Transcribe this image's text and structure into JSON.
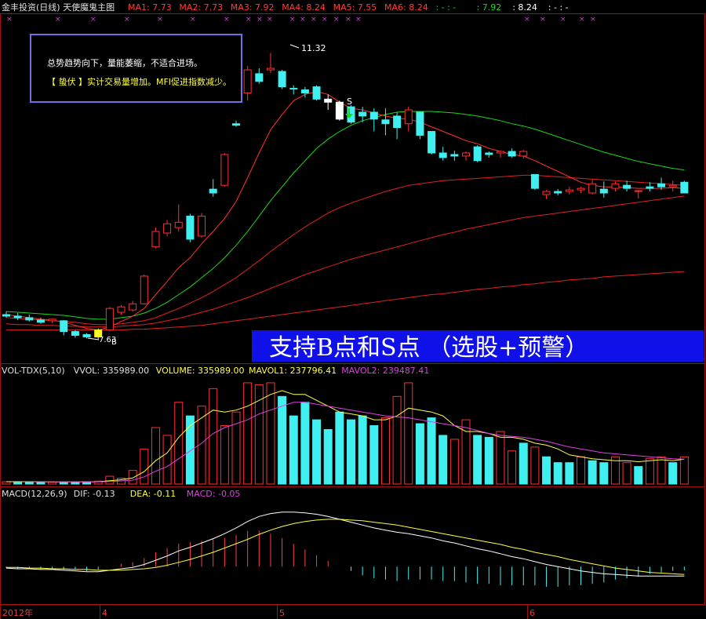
{
  "header": {
    "title": "金丰投资(日线) 天使魔鬼主图",
    "ma": [
      {
        "label": "MA1: 7.73",
        "color": "#ff3b3b"
      },
      {
        "label": "MA2: 7.73",
        "color": "#ff3b3b"
      },
      {
        "label": "MA3: 7.92",
        "color": "#ff3b3b"
      },
      {
        "label": "MA4: 8.24",
        "color": "#ff3b3b"
      },
      {
        "label": "MA5: 7.55",
        "color": "#ff3b3b"
      },
      {
        "label": "MA6: 8.24",
        "color": "#ff3b3b"
      },
      {
        "label": ": - : -",
        "color": "#18d818"
      },
      {
        "label": ": 7.92",
        "color": "#18d818"
      },
      {
        "label": ": 8.24",
        "color": "#ffffff"
      },
      {
        "label": ": - : -",
        "color": "#ffffff"
      }
    ]
  },
  "info_box": {
    "line1": "总势趋势向下，量能萎缩，不适合进场。",
    "line2": "【 蛰伏 】实计交易量增加。MFI促进指数减少。"
  },
  "banner": {
    "text": "支持B点和S点 （选股+预警）",
    "bg": "#1010e8"
  },
  "markers": {
    "b": "B",
    "s": "S",
    "high": "11.32",
    "low": "7.63"
  },
  "vol_header": [
    {
      "label": "VOL-TDX(5,10)",
      "color": "#e0e0e0"
    },
    {
      "label": "VVOL: 335989.00",
      "color": "#e0e0e0"
    },
    {
      "label": "VOLUME: 335989.00",
      "color": "#ffff40"
    },
    {
      "label": "MAVOL1: 237796.41",
      "color": "#ffff40"
    },
    {
      "label": "MAVOL2: 239487.41",
      "color": "#e040e0"
    }
  ],
  "macd_header": [
    {
      "label": "MACD(12,26,9)",
      "color": "#e0e0e0"
    },
    {
      "label": "DIF: -0.13",
      "color": "#e0e0e0"
    },
    {
      "label": "DEA: -0.11",
      "color": "#ffff40"
    },
    {
      "label": "MACD: -0.05",
      "color": "#e040e0"
    }
  ],
  "date_axis": [
    "2012年",
    "4",
    "5",
    "6"
  ],
  "chart_data": {
    "type": "candlestick",
    "price_ylim": [
      7.4,
      11.6
    ],
    "candles": [
      [
        7.92,
        7.96,
        7.88,
        7.9
      ],
      [
        7.9,
        7.94,
        7.85,
        7.88
      ],
      [
        7.88,
        7.92,
        7.83,
        7.85
      ],
      [
        7.85,
        7.88,
        7.8,
        7.82
      ],
      [
        7.84,
        7.87,
        7.81,
        7.86
      ],
      [
        7.84,
        7.85,
        7.65,
        7.7
      ],
      [
        7.7,
        7.72,
        7.62,
        7.65
      ],
      [
        7.66,
        7.68,
        7.61,
        7.63
      ],
      [
        7.63,
        7.74,
        7.6,
        7.72
      ],
      [
        7.72,
        8.02,
        7.7,
        8.0
      ],
      [
        7.95,
        8.04,
        7.92,
        8.02
      ],
      [
        7.98,
        8.1,
        7.96,
        8.06
      ],
      [
        8.06,
        8.44,
        8.05,
        8.42
      ],
      [
        8.8,
        9.05,
        8.78,
        9.0
      ],
      [
        8.98,
        9.15,
        8.94,
        9.1
      ],
      [
        9.05,
        9.35,
        9.0,
        9.12
      ],
      [
        9.2,
        9.23,
        8.86,
        8.9
      ],
      [
        8.94,
        9.24,
        8.92,
        9.2
      ],
      [
        9.55,
        9.68,
        9.45,
        9.5
      ],
      [
        9.6,
        10.02,
        9.58,
        10.0
      ],
      [
        10.4,
        10.44,
        10.36,
        10.38
      ],
      [
        10.8,
        11.15,
        10.7,
        11.1
      ],
      [
        11.05,
        11.12,
        10.92,
        10.95
      ],
      [
        11.1,
        11.32,
        11.06,
        11.12
      ],
      [
        11.08,
        11.1,
        10.85,
        10.88
      ],
      [
        10.86,
        10.9,
        10.78,
        10.85
      ],
      [
        10.84,
        10.88,
        10.74,
        10.8
      ],
      [
        10.88,
        10.9,
        10.7,
        10.72
      ],
      [
        10.72,
        10.78,
        10.58,
        10.68
      ],
      [
        10.68,
        10.7,
        10.44,
        10.46
      ],
      [
        10.62,
        10.64,
        10.4,
        10.42
      ],
      [
        10.55,
        10.62,
        10.42,
        10.5
      ],
      [
        10.55,
        10.6,
        10.3,
        10.46
      ],
      [
        10.45,
        10.6,
        10.25,
        10.4
      ],
      [
        10.5,
        10.55,
        10.2,
        10.35
      ],
      [
        10.4,
        10.62,
        10.3,
        10.58
      ],
      [
        10.55,
        10.55,
        10.2,
        10.25
      ],
      [
        10.3,
        10.3,
        10.0,
        10.02
      ],
      [
        10.02,
        10.1,
        9.92,
        9.96
      ],
      [
        10.0,
        10.05,
        9.92,
        9.98
      ],
      [
        9.98,
        10.04,
        9.92,
        10.02
      ],
      [
        10.1,
        10.12,
        9.9,
        9.92
      ],
      [
        10.02,
        10.04,
        9.96,
        10.0
      ],
      [
        10.02,
        10.05,
        9.96,
        10.04
      ],
      [
        10.04,
        10.08,
        9.96,
        9.98
      ],
      [
        9.98,
        10.06,
        9.95,
        10.04
      ],
      [
        9.74,
        9.74,
        9.54,
        9.56
      ],
      [
        9.48,
        9.54,
        9.42,
        9.52
      ],
      [
        9.52,
        9.55,
        9.47,
        9.5
      ],
      [
        9.52,
        9.58,
        9.48,
        9.54
      ],
      [
        9.54,
        9.58,
        9.5,
        9.56
      ],
      [
        9.5,
        9.68,
        9.48,
        9.62
      ],
      [
        9.55,
        9.65,
        9.44,
        9.5
      ],
      [
        9.56,
        9.65,
        9.52,
        9.62
      ],
      [
        9.6,
        9.66,
        9.52,
        9.56
      ],
      [
        9.53,
        9.54,
        9.43,
        9.53
      ],
      [
        9.58,
        9.64,
        9.52,
        9.56
      ],
      [
        9.62,
        9.7,
        9.54,
        9.58
      ],
      [
        9.58,
        9.66,
        9.52,
        9.6
      ],
      [
        9.64,
        9.66,
        9.5,
        9.5
      ]
    ],
    "ma_fast": [
      7.92,
      7.9,
      7.88,
      7.86,
      7.85,
      7.82,
      7.78,
      7.74,
      7.72,
      7.76,
      7.83,
      7.9,
      8.0,
      8.18,
      8.35,
      8.53,
      8.66,
      8.84,
      9.0,
      9.17,
      9.39,
      9.7,
      10.02,
      10.32,
      10.52,
      10.7,
      10.78,
      10.82,
      10.78,
      10.68,
      10.6,
      10.58,
      10.54,
      10.5,
      10.47,
      10.46,
      10.42,
      10.36,
      10.3,
      10.24,
      10.18,
      10.14,
      10.08,
      10.04,
      10.0,
      9.98,
      9.92,
      9.85,
      9.78,
      9.71,
      9.64,
      9.6,
      9.58,
      9.58,
      9.57,
      9.56,
      9.56,
      9.56,
      9.57,
      9.56
    ],
    "ma_green": [
      7.96,
      7.95,
      7.94,
      7.93,
      7.92,
      7.91,
      7.89,
      7.87,
      7.86,
      7.86,
      7.88,
      7.9,
      7.94,
      8.0,
      8.08,
      8.18,
      8.28,
      8.4,
      8.52,
      8.66,
      8.82,
      9.0,
      9.2,
      9.4,
      9.58,
      9.76,
      9.92,
      10.08,
      10.2,
      10.3,
      10.38,
      10.44,
      10.48,
      10.52,
      10.55,
      10.56,
      10.56,
      10.56,
      10.55,
      10.54,
      10.52,
      10.5,
      10.47,
      10.44,
      10.4,
      10.37,
      10.33,
      10.28,
      10.23,
      10.18,
      10.13,
      10.08,
      10.03,
      9.99,
      9.95,
      9.91,
      9.88,
      9.85,
      9.82,
      9.8
    ],
    "ma_slow1": [
      7.88,
      7.87,
      7.86,
      7.85,
      7.84,
      7.83,
      7.82,
      7.8,
      7.79,
      7.79,
      7.8,
      7.82,
      7.84,
      7.88,
      7.94,
      8.0,
      8.07,
      8.14,
      8.22,
      8.31,
      8.4,
      8.51,
      8.62,
      8.74,
      8.85,
      8.96,
      9.06,
      9.15,
      9.24,
      9.31,
      9.37,
      9.42,
      9.47,
      9.52,
      9.56,
      9.6,
      9.62,
      9.64,
      9.66,
      9.67,
      9.68,
      9.69,
      9.7,
      9.71,
      9.72,
      9.73,
      9.73,
      9.72,
      9.71,
      9.7,
      9.69,
      9.68,
      9.67,
      9.66,
      9.65,
      9.64,
      9.63,
      9.62,
      9.61,
      9.6
    ],
    "ma_slow2": [
      7.8,
      7.79,
      7.79,
      7.78,
      7.78,
      7.77,
      7.77,
      7.76,
      7.76,
      7.76,
      7.77,
      7.78,
      7.79,
      7.81,
      7.84,
      7.87,
      7.91,
      7.95,
      7.99,
      8.04,
      8.09,
      8.14,
      8.2,
      8.26,
      8.32,
      8.38,
      8.44,
      8.49,
      8.54,
      8.59,
      8.64,
      8.68,
      8.72,
      8.76,
      8.8,
      8.84,
      8.88,
      8.92,
      8.96,
      8.99,
      9.03,
      9.06,
      9.09,
      9.12,
      9.15,
      9.18,
      9.2,
      9.22,
      9.24,
      9.26,
      9.28,
      9.3,
      9.32,
      9.34,
      9.36,
      9.38,
      9.4,
      9.42,
      9.44,
      9.46
    ],
    "ma_slow3": [
      7.72,
      7.72,
      7.72,
      7.72,
      7.72,
      7.72,
      7.72,
      7.72,
      7.72,
      7.72,
      7.72,
      7.73,
      7.73,
      7.74,
      7.75,
      7.76,
      7.77,
      7.78,
      7.8,
      7.82,
      7.84,
      7.86,
      7.88,
      7.9,
      7.92,
      7.94,
      7.96,
      7.98,
      8.0,
      8.02,
      8.04,
      8.06,
      8.08,
      8.1,
      8.12,
      8.14,
      8.16,
      8.18,
      8.19,
      8.21,
      8.23,
      8.25,
      8.26,
      8.28,
      8.29,
      8.31,
      8.32,
      8.34,
      8.35,
      8.37,
      8.38,
      8.39,
      8.41,
      8.42,
      8.43,
      8.44,
      8.45,
      8.46,
      8.47,
      8.48
    ],
    "vol_ylim": [
      0,
      560000
    ],
    "volumes": [
      [
        12000,
        "up"
      ],
      [
        12000,
        "dn"
      ],
      [
        11000,
        "dn"
      ],
      [
        10000,
        "dn"
      ],
      [
        10000,
        "up"
      ],
      [
        11000,
        "dn"
      ],
      [
        11000,
        "dn"
      ],
      [
        12000,
        "dn"
      ],
      [
        15000,
        "up"
      ],
      [
        40000,
        "up"
      ],
      [
        30000,
        "up"
      ],
      [
        70000,
        "up"
      ],
      [
        180000,
        "up"
      ],
      [
        290000,
        "up"
      ],
      [
        250000,
        "up"
      ],
      [
        420000,
        "up"
      ],
      [
        350000,
        "dn"
      ],
      [
        400000,
        "up"
      ],
      [
        490000,
        "up"
      ],
      [
        300000,
        "up"
      ],
      [
        370000,
        "up"
      ],
      [
        520000,
        "up"
      ],
      [
        510000,
        "up"
      ],
      [
        520000,
        "up"
      ],
      [
        450000,
        "dn"
      ],
      [
        350000,
        "dn"
      ],
      [
        420000,
        "dn"
      ],
      [
        330000,
        "dn"
      ],
      [
        280000,
        "dn"
      ],
      [
        370000,
        "dn"
      ],
      [
        330000,
        "dn"
      ],
      [
        350000,
        "dn"
      ],
      [
        300000,
        "dn"
      ],
      [
        340000,
        "up"
      ],
      [
        450000,
        "up"
      ],
      [
        520000,
        "up"
      ],
      [
        310000,
        "dn"
      ],
      [
        340000,
        "dn"
      ],
      [
        250000,
        "dn"
      ],
      [
        230000,
        "up"
      ],
      [
        330000,
        "up"
      ],
      [
        250000,
        "dn"
      ],
      [
        240000,
        "dn"
      ],
      [
        270000,
        "up"
      ],
      [
        170000,
        "up"
      ],
      [
        210000,
        "dn"
      ],
      [
        190000,
        "up"
      ],
      [
        140000,
        "dn"
      ],
      [
        110000,
        "dn"
      ],
      [
        110000,
        "dn"
      ],
      [
        140000,
        "up"
      ],
      [
        120000,
        "dn"
      ],
      [
        110000,
        "dn"
      ],
      [
        140000,
        "up"
      ],
      [
        110000,
        "up"
      ],
      [
        90000,
        "dn"
      ],
      [
        130000,
        "up"
      ],
      [
        140000,
        "up"
      ],
      [
        110000,
        "dn"
      ],
      [
        140000,
        "up"
      ]
    ],
    "mavol1": [
      12000,
      12000,
      12000,
      11500,
      11000,
      11000,
      11000,
      11000,
      12000,
      17000,
      22000,
      31000,
      64000,
      120000,
      160000,
      240000,
      300000,
      340000,
      380000,
      370000,
      380000,
      400000,
      430000,
      460000,
      480000,
      460000,
      460000,
      430000,
      400000,
      370000,
      360000,
      350000,
      330000,
      330000,
      350000,
      390000,
      380000,
      370000,
      350000,
      300000,
      270000,
      270000,
      260000,
      240000,
      240000,
      230000,
      210000,
      200000,
      180000,
      150000,
      140000,
      130000,
      125000,
      120000,
      120000,
      115000,
      120000,
      125000,
      120000,
      128000
    ],
    "mavol2": [
      14000,
      13500,
      13000,
      12500,
      12000,
      11500,
      11500,
      11000,
      11500,
      13000,
      16000,
      20000,
      37000,
      66000,
      90000,
      130000,
      170000,
      210000,
      260000,
      290000,
      310000,
      330000,
      360000,
      380000,
      400000,
      420000,
      420000,
      410000,
      400000,
      390000,
      380000,
      370000,
      360000,
      350000,
      345000,
      340000,
      330000,
      320000,
      310000,
      300000,
      290000,
      275000,
      260000,
      250000,
      245000,
      240000,
      230000,
      220000,
      205000,
      190000,
      180000,
      170000,
      160000,
      155000,
      150000,
      145000,
      140000,
      135000,
      130000,
      128000
    ],
    "macd_ylim": [
      -0.5,
      0.9
    ],
    "dif": [
      -0.02,
      -0.03,
      -0.03,
      -0.04,
      -0.04,
      -0.05,
      -0.06,
      -0.07,
      -0.07,
      -0.05,
      -0.03,
      -0.01,
      0.03,
      0.09,
      0.15,
      0.22,
      0.27,
      0.33,
      0.39,
      0.46,
      0.54,
      0.63,
      0.7,
      0.74,
      0.76,
      0.76,
      0.75,
      0.73,
      0.7,
      0.66,
      0.62,
      0.58,
      0.54,
      0.51,
      0.48,
      0.46,
      0.43,
      0.4,
      0.36,
      0.33,
      0.29,
      0.25,
      0.22,
      0.18,
      0.14,
      0.11,
      0.07,
      0.03,
      0.0,
      -0.03,
      -0.06,
      -0.08,
      -0.1,
      -0.11,
      -0.12,
      -0.13,
      -0.13,
      -0.13,
      -0.13,
      -0.13
    ],
    "dea": [
      -0.01,
      -0.01,
      -0.02,
      -0.02,
      -0.03,
      -0.03,
      -0.04,
      -0.04,
      -0.05,
      -0.05,
      -0.05,
      -0.04,
      -0.03,
      -0.01,
      0.02,
      0.06,
      0.1,
      0.15,
      0.2,
      0.26,
      0.32,
      0.38,
      0.45,
      0.51,
      0.56,
      0.6,
      0.63,
      0.65,
      0.66,
      0.66,
      0.65,
      0.64,
      0.62,
      0.6,
      0.58,
      0.55,
      0.52,
      0.49,
      0.46,
      0.43,
      0.4,
      0.37,
      0.34,
      0.31,
      0.27,
      0.24,
      0.2,
      0.17,
      0.14,
      0.1,
      0.07,
      0.04,
      0.01,
      -0.02,
      -0.04,
      -0.06,
      -0.08,
      -0.09,
      -0.1,
      -0.11
    ],
    "macd": [
      -0.02,
      -0.03,
      -0.03,
      -0.04,
      -0.03,
      -0.04,
      -0.04,
      -0.06,
      -0.04,
      0.0,
      0.04,
      0.06,
      0.12,
      0.2,
      0.26,
      0.32,
      0.34,
      0.36,
      0.38,
      0.4,
      0.44,
      0.5,
      0.5,
      0.46,
      0.4,
      0.32,
      0.24,
      0.16,
      0.08,
      0.0,
      -0.06,
      -0.12,
      -0.16,
      -0.18,
      -0.2,
      -0.18,
      -0.18,
      -0.18,
      -0.2,
      -0.2,
      -0.22,
      -0.24,
      -0.24,
      -0.26,
      -0.26,
      -0.26,
      -0.26,
      -0.28,
      -0.28,
      -0.26,
      -0.26,
      -0.24,
      -0.22,
      -0.18,
      -0.16,
      -0.14,
      -0.1,
      -0.08,
      -0.06,
      -0.05
    ]
  }
}
